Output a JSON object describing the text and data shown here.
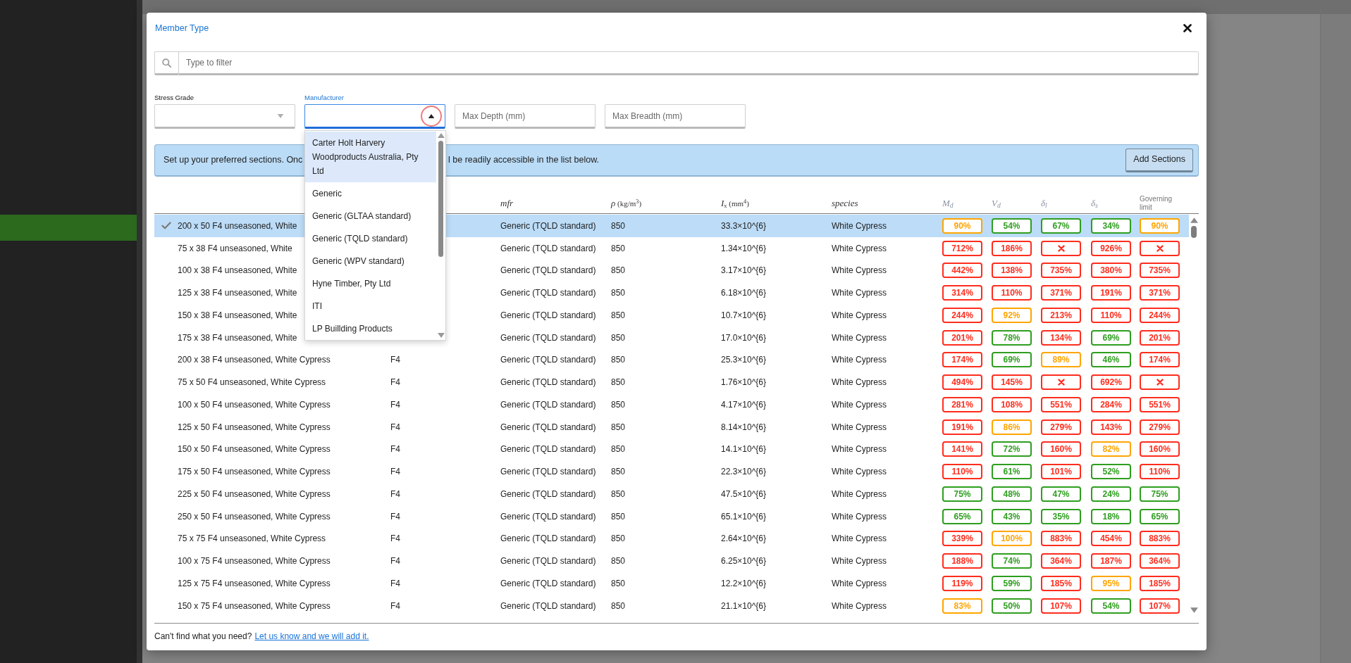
{
  "dialog": {
    "title": "Member Type"
  },
  "filter": {
    "placeholder": "Type to filter"
  },
  "filters": [
    {
      "kind": "select",
      "label": "Stress Grade",
      "expanded": false
    },
    {
      "kind": "combo",
      "label": "Manufacturer",
      "expanded": true,
      "click_indicator": true,
      "options": [
        {
          "label": "Carter Holt Harvery Woodproducts Australia, Pty Ltd",
          "selected": true
        },
        {
          "label": "Generic",
          "selected": false
        },
        {
          "label": "Generic (GLTAA standard)",
          "selected": false
        },
        {
          "label": "Generic (TQLD standard)",
          "selected": false
        },
        {
          "label": "Generic (WPV standard)",
          "selected": false
        },
        {
          "label": "Hyne Timber, Pty Ltd",
          "selected": false
        },
        {
          "label": "ITI",
          "selected": false
        },
        {
          "label": "LP Buillding Products",
          "selected": false
        }
      ]
    },
    {
      "kind": "input",
      "placeholder": "Max Depth (mm)"
    },
    {
      "kind": "input",
      "placeholder": "Max Breadth (mm)"
    }
  ],
  "notice": {
    "texts": [
      "Set up your preferred sections. Onc",
      "l be readily accessible in the list below."
    ],
    "button": "Add Sections"
  },
  "table": {
    "columns": [
      {
        "label": "mfr",
        "kind": "math"
      },
      {
        "label": "*ρ* (kg/m$^{3}$)",
        "kind": "unit"
      },
      {
        "label": "*I*$_{x}$ (mm$^{4}$)",
        "kind": "unit"
      },
      {
        "label": "species",
        "kind": "math"
      },
      {
        "label": "M$_{d}$",
        "kind": "check"
      },
      {
        "label": "V$_{d}$",
        "kind": "check"
      },
      {
        "label": "δ$_{l}$",
        "kind": "check"
      },
      {
        "label": "δ$_{s}$",
        "kind": "check"
      },
      {
        "label": "Governing limit",
        "kind": "text"
      }
    ],
    "rows": [
      {
        "selected": true,
        "section": "200 x 50 F4 unseasoned, White",
        "manufacturer": "Generic (TQLD standard)",
        "density": "850",
        "ix": "33.3×10^{6}",
        "species": "White Cypress",
        "checks": [
          {
            "kind": "percent",
            "value": "90%",
            "color": "#ffa500"
          },
          {
            "kind": "percent",
            "value": "54%",
            "color": "#2e9e1f"
          },
          {
            "kind": "percent",
            "value": "67%",
            "color": "#2e9e1f"
          },
          {
            "kind": "percent",
            "value": "34%",
            "color": "#2e9e1f"
          },
          {
            "kind": "percent",
            "value": "90%",
            "color": "#ffa500"
          }
        ]
      },
      {
        "selected": false,
        "section": "75 x 38 F4 unseasoned, White",
        "manufacturer": "Generic (TQLD standard)",
        "density": "850",
        "ix": "1.34×10^{6}",
        "species": "White Cypress",
        "checks": [
          {
            "kind": "percent",
            "value": "712%",
            "color": "#ff2d1e"
          },
          {
            "kind": "percent",
            "value": "186%",
            "color": "#ff2d1e"
          },
          {
            "kind": "cross",
            "color": "#ff2d1e"
          },
          {
            "kind": "percent",
            "value": "926%",
            "color": "#ff2d1e"
          },
          {
            "kind": "cross",
            "color": "#ff2d1e"
          }
        ]
      },
      {
        "selected": false,
        "section": "100 x 38 F4 unseasoned, White",
        "manufacturer": "Generic (TQLD standard)",
        "density": "850",
        "ix": "3.17×10^{6}",
        "species": "White Cypress",
        "checks": [
          {
            "kind": "percent",
            "value": "442%",
            "color": "#ff2d1e"
          },
          {
            "kind": "percent",
            "value": "138%",
            "color": "#ff2d1e"
          },
          {
            "kind": "percent",
            "value": "735%",
            "color": "#ff2d1e"
          },
          {
            "kind": "percent",
            "value": "380%",
            "color": "#ff2d1e"
          },
          {
            "kind": "percent",
            "value": "735%",
            "color": "#ff2d1e"
          }
        ]
      },
      {
        "selected": false,
        "section": "125 x 38 F4 unseasoned, White",
        "manufacturer": "Generic (TQLD standard)",
        "density": "850",
        "ix": "6.18×10^{6}",
        "species": "White Cypress",
        "checks": [
          {
            "kind": "percent",
            "value": "314%",
            "color": "#ff2d1e"
          },
          {
            "kind": "percent",
            "value": "110%",
            "color": "#ff2d1e"
          },
          {
            "kind": "percent",
            "value": "371%",
            "color": "#ff2d1e"
          },
          {
            "kind": "percent",
            "value": "191%",
            "color": "#ff2d1e"
          },
          {
            "kind": "percent",
            "value": "371%",
            "color": "#ff2d1e"
          }
        ]
      },
      {
        "selected": false,
        "section": "150 x 38 F4 unseasoned, White",
        "manufacturer": "Generic (TQLD standard)",
        "density": "850",
        "ix": "10.7×10^{6}",
        "species": "White Cypress",
        "checks": [
          {
            "kind": "percent",
            "value": "244%",
            "color": "#ff2d1e"
          },
          {
            "kind": "percent",
            "value": "92%",
            "color": "#ffa500"
          },
          {
            "kind": "percent",
            "value": "213%",
            "color": "#ff2d1e"
          },
          {
            "kind": "percent",
            "value": "110%",
            "color": "#ff2d1e"
          },
          {
            "kind": "percent",
            "value": "244%",
            "color": "#ff2d1e"
          }
        ]
      },
      {
        "selected": false,
        "section": "175 x 38 F4 unseasoned, White",
        "manufacturer": "Generic (TQLD standard)",
        "density": "850",
        "ix": "17.0×10^{6}",
        "species": "White Cypress",
        "checks": [
          {
            "kind": "percent",
            "value": "201%",
            "color": "#ff2d1e"
          },
          {
            "kind": "percent",
            "value": "78%",
            "color": "#2e9e1f"
          },
          {
            "kind": "percent",
            "value": "134%",
            "color": "#ff2d1e"
          },
          {
            "kind": "percent",
            "value": "69%",
            "color": "#2e9e1f"
          },
          {
            "kind": "percent",
            "value": "201%",
            "color": "#ff2d1e"
          }
        ]
      },
      {
        "selected": false,
        "section": "200 x 38 F4 unseasoned, White Cypress",
        "grade": "F4",
        "manufacturer": "Generic (TQLD standard)",
        "density": "850",
        "ix": "25.3×10^{6}",
        "species": "White Cypress",
        "checks": [
          {
            "kind": "percent",
            "value": "174%",
            "color": "#ff2d1e"
          },
          {
            "kind": "percent",
            "value": "69%",
            "color": "#2e9e1f"
          },
          {
            "kind": "percent",
            "value": "89%",
            "color": "#ffa500"
          },
          {
            "kind": "percent",
            "value": "46%",
            "color": "#2e9e1f"
          },
          {
            "kind": "percent",
            "value": "174%",
            "color": "#ff2d1e"
          }
        ]
      },
      {
        "selected": false,
        "section": "75 x 50 F4 unseasoned, White Cypress",
        "grade": "F4",
        "manufacturer": "Generic (TQLD standard)",
        "density": "850",
        "ix": "1.76×10^{6}",
        "species": "White Cypress",
        "checks": [
          {
            "kind": "percent",
            "value": "494%",
            "color": "#ff2d1e"
          },
          {
            "kind": "percent",
            "value": "145%",
            "color": "#ff2d1e"
          },
          {
            "kind": "cross",
            "color": "#ff2d1e"
          },
          {
            "kind": "percent",
            "value": "692%",
            "color": "#ff2d1e"
          },
          {
            "kind": "cross",
            "color": "#ff2d1e"
          }
        ]
      },
      {
        "selected": false,
        "section": "100 x 50 F4 unseasoned, White Cypress",
        "grade": "F4",
        "manufacturer": "Generic (TQLD standard)",
        "density": "850",
        "ix": "4.17×10^{6}",
        "species": "White Cypress",
        "checks": [
          {
            "kind": "percent",
            "value": "281%",
            "color": "#ff2d1e"
          },
          {
            "kind": "percent",
            "value": "108%",
            "color": "#ff2d1e"
          },
          {
            "kind": "percent",
            "value": "551%",
            "color": "#ff2d1e"
          },
          {
            "kind": "percent",
            "value": "284%",
            "color": "#ff2d1e"
          },
          {
            "kind": "percent",
            "value": "551%",
            "color": "#ff2d1e"
          }
        ]
      },
      {
        "selected": false,
        "section": "125 x 50 F4 unseasoned, White Cypress",
        "grade": "F4",
        "manufacturer": "Generic (TQLD standard)",
        "density": "850",
        "ix": "8.14×10^{6}",
        "species": "White Cypress",
        "checks": [
          {
            "kind": "percent",
            "value": "191%",
            "color": "#ff2d1e"
          },
          {
            "kind": "percent",
            "value": "86%",
            "color": "#ffa500"
          },
          {
            "kind": "percent",
            "value": "279%",
            "color": "#ff2d1e"
          },
          {
            "kind": "percent",
            "value": "143%",
            "color": "#ff2d1e"
          },
          {
            "kind": "percent",
            "value": "279%",
            "color": "#ff2d1e"
          }
        ]
      },
      {
        "selected": false,
        "section": "150 x 50 F4 unseasoned, White Cypress",
        "grade": "F4",
        "manufacturer": "Generic (TQLD standard)",
        "density": "850",
        "ix": "14.1×10^{6}",
        "species": "White Cypress",
        "checks": [
          {
            "kind": "percent",
            "value": "141%",
            "color": "#ff2d1e"
          },
          {
            "kind": "percent",
            "value": "72%",
            "color": "#2e9e1f"
          },
          {
            "kind": "percent",
            "value": "160%",
            "color": "#ff2d1e"
          },
          {
            "kind": "percent",
            "value": "82%",
            "color": "#ffa500"
          },
          {
            "kind": "percent",
            "value": "160%",
            "color": "#ff2d1e"
          }
        ]
      },
      {
        "selected": false,
        "section": "175 x 50 F4 unseasoned, White Cypress",
        "grade": "F4",
        "manufacturer": "Generic (TQLD standard)",
        "density": "850",
        "ix": "22.3×10^{6}",
        "species": "White Cypress",
        "checks": [
          {
            "kind": "percent",
            "value": "110%",
            "color": "#ff2d1e"
          },
          {
            "kind": "percent",
            "value": "61%",
            "color": "#2e9e1f"
          },
          {
            "kind": "percent",
            "value": "101%",
            "color": "#ff2d1e"
          },
          {
            "kind": "percent",
            "value": "52%",
            "color": "#2e9e1f"
          },
          {
            "kind": "percent",
            "value": "110%",
            "color": "#ff2d1e"
          }
        ]
      },
      {
        "selected": false,
        "section": "225 x 50 F4 unseasoned, White Cypress",
        "grade": "F4",
        "manufacturer": "Generic (TQLD standard)",
        "density": "850",
        "ix": "47.5×10^{6}",
        "species": "White Cypress",
        "checks": [
          {
            "kind": "percent",
            "value": "75%",
            "color": "#2e9e1f"
          },
          {
            "kind": "percent",
            "value": "48%",
            "color": "#2e9e1f"
          },
          {
            "kind": "percent",
            "value": "47%",
            "color": "#2e9e1f"
          },
          {
            "kind": "percent",
            "value": "24%",
            "color": "#2e9e1f"
          },
          {
            "kind": "percent",
            "value": "75%",
            "color": "#2e9e1f"
          }
        ]
      },
      {
        "selected": false,
        "section": "250 x 50 F4 unseasoned, White Cypress",
        "grade": "F4",
        "manufacturer": "Generic (TQLD standard)",
        "density": "850",
        "ix": "65.1×10^{6}",
        "species": "White Cypress",
        "checks": [
          {
            "kind": "percent",
            "value": "65%",
            "color": "#2e9e1f"
          },
          {
            "kind": "percent",
            "value": "43%",
            "color": "#2e9e1f"
          },
          {
            "kind": "percent",
            "value": "35%",
            "color": "#2e9e1f"
          },
          {
            "kind": "percent",
            "value": "18%",
            "color": "#2e9e1f"
          },
          {
            "kind": "percent",
            "value": "65%",
            "color": "#2e9e1f"
          }
        ]
      },
      {
        "selected": false,
        "section": "75 x 75 F4 unseasoned, White Cypress",
        "grade": "F4",
        "manufacturer": "Generic (TQLD standard)",
        "density": "850",
        "ix": "2.64×10^{6}",
        "species": "White Cypress",
        "checks": [
          {
            "kind": "percent",
            "value": "339%",
            "color": "#ff2d1e"
          },
          {
            "kind": "percent",
            "value": "100%",
            "color": "#ffa500"
          },
          {
            "kind": "percent",
            "value": "883%",
            "color": "#ff2d1e"
          },
          {
            "kind": "percent",
            "value": "454%",
            "color": "#ff2d1e"
          },
          {
            "kind": "percent",
            "value": "883%",
            "color": "#ff2d1e"
          }
        ]
      },
      {
        "selected": false,
        "section": "100 x 75 F4 unseasoned, White Cypress",
        "grade": "F4",
        "manufacturer": "Generic (TQLD standard)",
        "density": "850",
        "ix": "6.25×10^{6}",
        "species": "White Cypress",
        "checks": [
          {
            "kind": "percent",
            "value": "188%",
            "color": "#ff2d1e"
          },
          {
            "kind": "percent",
            "value": "74%",
            "color": "#2e9e1f"
          },
          {
            "kind": "percent",
            "value": "364%",
            "color": "#ff2d1e"
          },
          {
            "kind": "percent",
            "value": "187%",
            "color": "#ff2d1e"
          },
          {
            "kind": "percent",
            "value": "364%",
            "color": "#ff2d1e"
          }
        ]
      },
      {
        "selected": false,
        "section": "125 x 75 F4 unseasoned, White Cypress",
        "grade": "F4",
        "manufacturer": "Generic (TQLD standard)",
        "density": "850",
        "ix": "12.2×10^{6}",
        "species": "White Cypress",
        "checks": [
          {
            "kind": "percent",
            "value": "119%",
            "color": "#ff2d1e"
          },
          {
            "kind": "percent",
            "value": "59%",
            "color": "#2e9e1f"
          },
          {
            "kind": "percent",
            "value": "185%",
            "color": "#ff2d1e"
          },
          {
            "kind": "percent",
            "value": "95%",
            "color": "#ffa500"
          },
          {
            "kind": "percent",
            "value": "185%",
            "color": "#ff2d1e"
          }
        ]
      },
      {
        "selected": false,
        "section": "150 x 75 F4 unseasoned, White Cypress",
        "grade": "F4",
        "manufacturer": "Generic (TQLD standard)",
        "density": "850",
        "ix": "21.1×10^{6}",
        "species": "White Cypress",
        "checks": [
          {
            "kind": "percent",
            "value": "83%",
            "color": "#ffa500"
          },
          {
            "kind": "percent",
            "value": "50%",
            "color": "#2e9e1f"
          },
          {
            "kind": "percent",
            "value": "107%",
            "color": "#ff2d1e"
          },
          {
            "kind": "percent",
            "value": "54%",
            "color": "#2e9e1f"
          },
          {
            "kind": "percent",
            "value": "107%",
            "color": "#ff2d1e"
          }
        ]
      }
    ]
  },
  "footer": {
    "text": "Can't find what you need?",
    "link": "Let us know and we will add it."
  }
}
